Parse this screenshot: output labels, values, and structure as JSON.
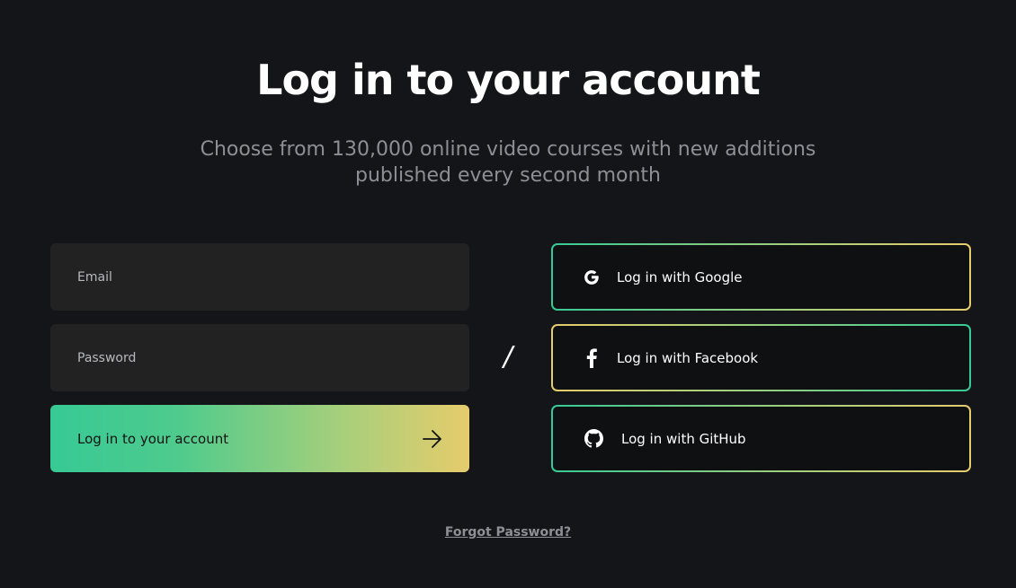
{
  "header": {
    "title": "Log in to your account",
    "subtitle": "Choose from 130,000 online video courses with new additions published every second month"
  },
  "form": {
    "email_placeholder": "Email",
    "password_placeholder": "Password",
    "submit_label": "Log in to your account",
    "submit_icon": "arrow-right-icon"
  },
  "divider": "/",
  "social": [
    {
      "label": "Log in with Google",
      "icon": "google-icon"
    },
    {
      "label": "Log in with Facebook",
      "icon": "facebook-icon"
    },
    {
      "label": "Log in with GitHub",
      "icon": "github-icon"
    }
  ],
  "forgot_password": "Forgot Password?",
  "colors": {
    "background": "#141518",
    "field_bg": "#222223",
    "gradient_start": "#37c995",
    "gradient_end": "#e6cc6c",
    "muted_text": "#8e8f94"
  }
}
